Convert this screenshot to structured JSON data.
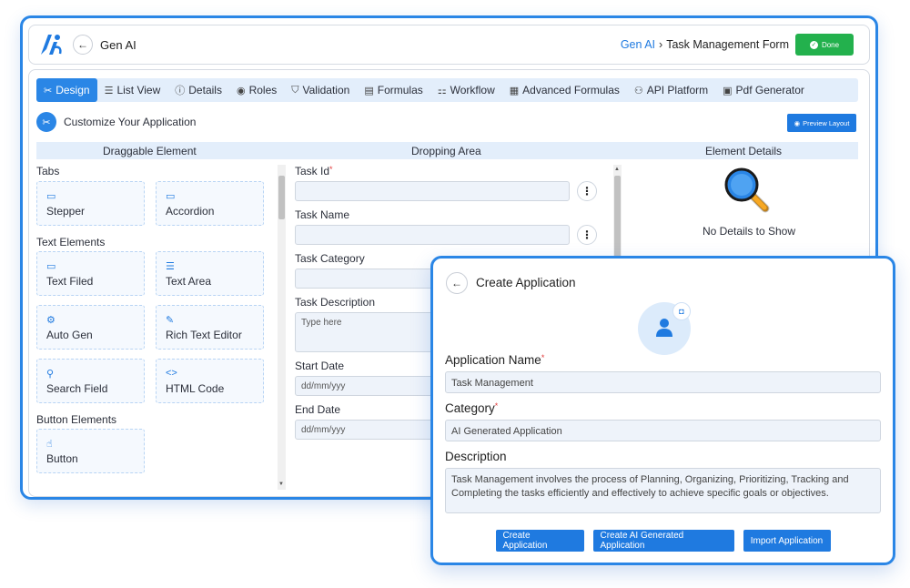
{
  "header": {
    "app_title": "Gen AI",
    "breadcrumb_root": "Gen AI",
    "breadcrumb_sep": "›",
    "breadcrumb_current": "Task Management Form",
    "done_label": "Done",
    "done_icon": "check-circle-icon"
  },
  "tabs": [
    {
      "label": "Design",
      "icon": "design-tools-icon",
      "active": true
    },
    {
      "label": "List View",
      "icon": "list-icon"
    },
    {
      "label": "Details",
      "icon": "info-icon"
    },
    {
      "label": "Roles",
      "icon": "roles-icon"
    },
    {
      "label": "Validation",
      "icon": "shield-icon"
    },
    {
      "label": "Formulas",
      "icon": "document-icon"
    },
    {
      "label": "Workflow",
      "icon": "workflow-icon"
    },
    {
      "label": "Advanced Formulas",
      "icon": "calendar-icon"
    },
    {
      "label": "API Platform",
      "icon": "api-icon"
    },
    {
      "label": "Pdf Generator",
      "icon": "pdf-icon"
    }
  ],
  "customize": {
    "label": "Customize Your Application",
    "preview_label": "Preview Layout"
  },
  "sections": {
    "draggable": "Draggable Element",
    "dropping": "Dropping Area",
    "details": "Element Details"
  },
  "draggable": {
    "groups": [
      {
        "title": "Tabs",
        "items": [
          {
            "label": "Stepper",
            "icon": "chat-icon"
          },
          {
            "label": "Accordion",
            "icon": "chat-icon"
          }
        ]
      },
      {
        "title": "Text Elements",
        "items": [
          {
            "label": "Text Filed",
            "icon": "chat-icon"
          },
          {
            "label": "Text Area",
            "icon": "chat-lines-icon"
          },
          {
            "label": "Auto Gen",
            "icon": "gear-icon"
          },
          {
            "label": "Rich Text Editor",
            "icon": "highlighter-icon"
          },
          {
            "label": "Search Field",
            "icon": "search-icon"
          },
          {
            "label": "HTML Code",
            "icon": "code-icon"
          }
        ]
      },
      {
        "title": "Button Elements",
        "items": [
          {
            "label": "Button",
            "icon": "pointer-icon"
          }
        ]
      }
    ]
  },
  "dropping": {
    "fields": [
      {
        "label": "Task Id",
        "required": true,
        "value": ""
      },
      {
        "label": "Task Name",
        "required": false,
        "value": ""
      },
      {
        "label": "Task Category",
        "required": false,
        "value": ""
      },
      {
        "label": "Task Description",
        "required": false,
        "placeholder": "Type here"
      },
      {
        "label": "Start Date",
        "required": false,
        "placeholder": "dd/mm/yyy"
      },
      {
        "label": "End Date",
        "required": false,
        "placeholder": "dd/mm/yyy"
      }
    ]
  },
  "details": {
    "empty_text": "No Details to Show",
    "icon": "magnifier-icon"
  },
  "modal": {
    "title": "Create Application",
    "camera_icon": "camera-icon",
    "name_label": "Application Name",
    "name_value": "Task Management",
    "category_label": "Category",
    "category_value": "AI Generated Application",
    "description_label": "Description",
    "description_value": "Task Management involves the process of Planning, Organizing, Prioritizing, Tracking and Completing the tasks efficiently and effectively to achieve specific goals or objectives.",
    "buttons": [
      "Create Application",
      "Create AI Generated Application",
      "Import Application"
    ]
  },
  "colors": {
    "accent": "#2a86e6",
    "done": "#23b14d",
    "required": "#e23b3b"
  }
}
